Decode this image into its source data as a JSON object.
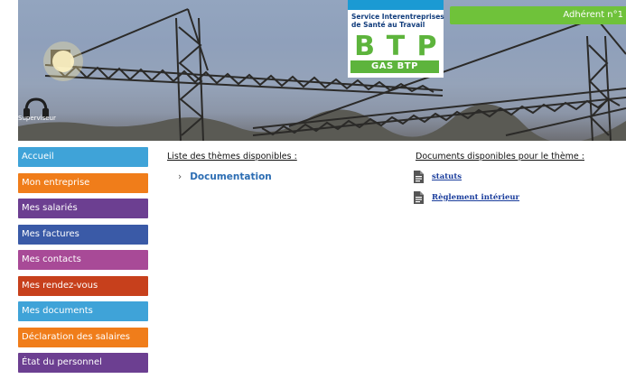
{
  "header": {
    "logo": {
      "line1": "Service Interentreprises",
      "line2": "de Santé au Travail",
      "letters": [
        "B",
        "T",
        "P"
      ],
      "org": "GAS BTP",
      "colors": {
        "green": "#5db43c",
        "blue": "#1b9ad3",
        "navy": "#123d7c"
      }
    },
    "adherent_label": "Adhérent n°1",
    "supervisor_label": "Superviseur",
    "supervisor_icon": "headset-icon"
  },
  "sidebar": {
    "items": [
      {
        "label": "Accueil",
        "color": "#3fa3d8"
      },
      {
        "label": "Mon entreprise",
        "color": "#f07d1a"
      },
      {
        "label": "Mes salariés",
        "color": "#6c3f91"
      },
      {
        "label": "Mes factures",
        "color": "#3a5aa7"
      },
      {
        "label": "Mes contacts",
        "color": "#a84a97"
      },
      {
        "label": "Mes rendez-vous",
        "color": "#c7401c"
      },
      {
        "label": "Mes documents",
        "color": "#3fa3d8"
      },
      {
        "label": "Déclaration des salaires",
        "color": "#f07d1a"
      },
      {
        "label": "État du personnel",
        "color": "#6c3f91"
      }
    ]
  },
  "main": {
    "themes_title": "Liste des thèmes disponibles :",
    "themes": [
      {
        "label": "Documentation",
        "icon": "chevron-right-icon"
      }
    ],
    "documents_title": "Documents disponibles pour le thème :",
    "documents": [
      {
        "label": "statuts",
        "icon": "document-icon"
      },
      {
        "label": "Règlement intérieur",
        "icon": "document-icon"
      }
    ]
  }
}
